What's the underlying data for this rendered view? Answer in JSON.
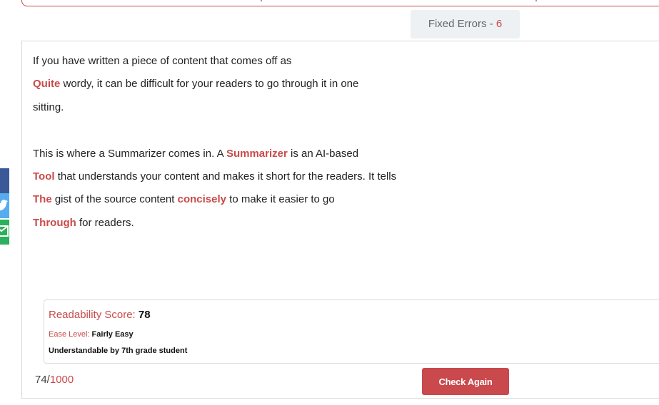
{
  "header": {
    "fixed_errors_label": "Fixed Errors - ",
    "fixed_errors_count": "6"
  },
  "editor": {
    "lines": [
      {
        "segments": [
          {
            "text": "If you have written a piece of content that comes off as",
            "highlight": false
          }
        ]
      },
      {
        "segments": [
          {
            "text": "Quite",
            "highlight": true
          },
          {
            "text": " wordy, it can be difficult for your readers to go through it in one",
            "highlight": false
          }
        ]
      },
      {
        "segments": [
          {
            "text": "sitting.",
            "highlight": false
          }
        ]
      },
      {
        "segments": []
      },
      {
        "segments": [
          {
            "text": "This is where a Summarizer comes in. A ",
            "highlight": false
          },
          {
            "text": "Summarizer",
            "highlight": true
          },
          {
            "text": " is an AI-based",
            "highlight": false
          }
        ]
      },
      {
        "segments": [
          {
            "text": "Tool",
            "highlight": true
          },
          {
            "text": " that understands your content and makes it short for the readers. It tells",
            "highlight": false
          }
        ]
      },
      {
        "segments": [
          {
            "text": "The",
            "highlight": true
          },
          {
            "text": " gist of the source content ",
            "highlight": false
          },
          {
            "text": "concisely",
            "highlight": true
          },
          {
            "text": " to make it easier to go",
            "highlight": false
          }
        ]
      },
      {
        "segments": [
          {
            "text": "Through",
            "highlight": true
          },
          {
            "text": " for readers.",
            "highlight": false
          }
        ]
      }
    ]
  },
  "readability": {
    "score_label": "Readability Score: ",
    "score_value": "78",
    "ease_label": "Ease Level: ",
    "ease_value": "Fairly Easy",
    "grade_text": "Understandable by 7th grade student"
  },
  "footer": {
    "char_count": "74/",
    "char_max": "1000",
    "check_again_label": "Check Again"
  },
  "share": {
    "items": [
      {
        "name": "facebook-share-button",
        "icon": "facebook-icon",
        "color": "#3b5998"
      },
      {
        "name": "twitter-share-button",
        "icon": "twitter-icon",
        "color": "#55acee"
      },
      {
        "name": "email-share-button",
        "icon": "email-icon",
        "color": "#2bb05b"
      }
    ]
  },
  "colors": {
    "accent": "#c94a4a",
    "button": "#c9494d"
  }
}
